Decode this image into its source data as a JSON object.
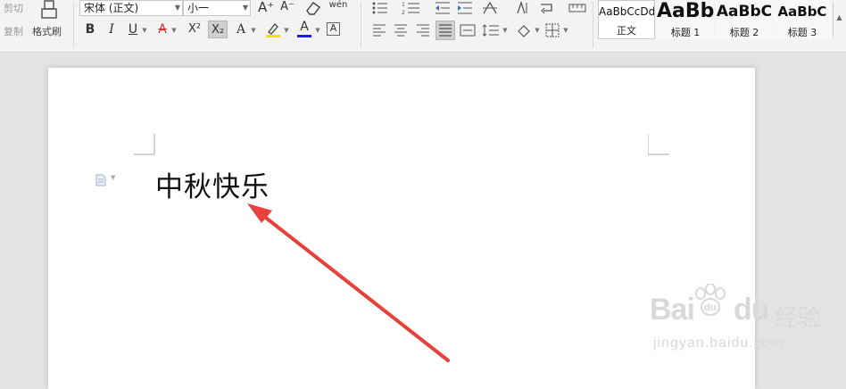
{
  "ribbon": {
    "clipboard": {
      "cut_label": "剪切",
      "copy_label": "复制",
      "format_painter_label": "格式刷"
    },
    "font": {
      "family": "宋体 (正文)",
      "size": "小一",
      "bold_label": "B",
      "italic_label": "I",
      "underline_label": "U",
      "strike_label": "A",
      "superscript_label": "X²",
      "subscript_label": "X₂",
      "effects_label": "A",
      "highlight_label": "ab",
      "font_color_label": "A",
      "char_border_label": "A",
      "grow_label": "A⁺",
      "shrink_label": "A⁻",
      "phonetic_label": "wén"
    },
    "styles": [
      {
        "sample": "AaBbCcDd",
        "name": "正文"
      },
      {
        "sample": "AaBb",
        "name": "标题 1"
      },
      {
        "sample": "AaBbC",
        "name": "标题 2"
      },
      {
        "sample": "AaBbC",
        "name": "标题 3"
      }
    ],
    "colors": {
      "highlight": "#f5e100",
      "font_color": "#1a1aff",
      "strike_color": "#d03030"
    }
  },
  "document": {
    "text": "中秋快乐"
  },
  "annotation": {
    "arrow_color": "#e8403a"
  },
  "watermark": {
    "brand_latin": "Bai",
    "brand_latin2": "du",
    "brand_cn": "经验",
    "url": "jingyan.baidu.com"
  }
}
